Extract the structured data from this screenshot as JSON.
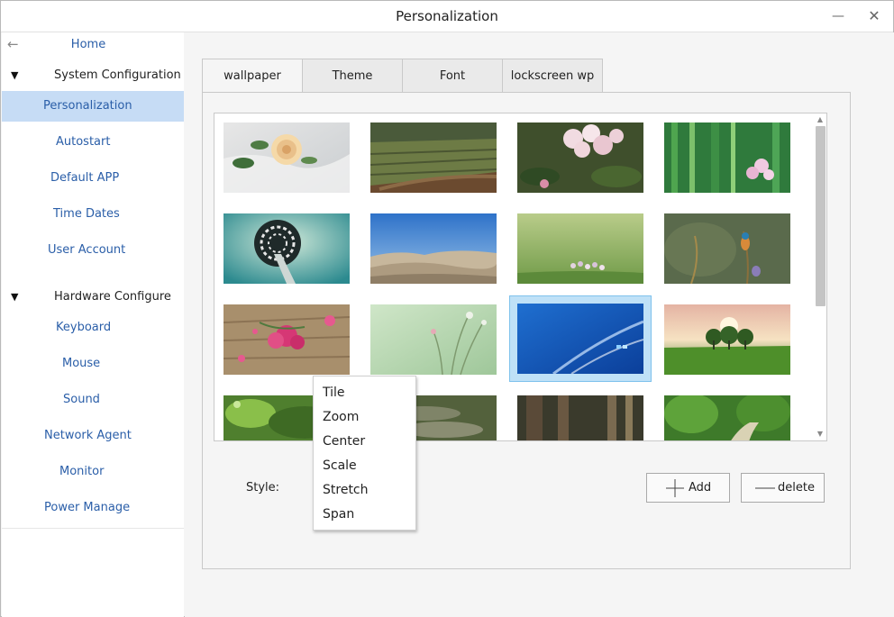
{
  "window": {
    "title": "Personalization",
    "minimize_glyph": "—",
    "close_glyph": "✕"
  },
  "sidebar": {
    "back_glyph": "←",
    "home_label": "Home",
    "groups": [
      {
        "label": "System Configuration",
        "expander_glyph": "▼"
      },
      {
        "label": "Hardware Configure",
        "expander_glyph": "▼"
      }
    ],
    "items": [
      {
        "label": "Personalization",
        "active": true
      },
      {
        "label": "Autostart"
      },
      {
        "label": "Default APP"
      },
      {
        "label": "Time Dates"
      },
      {
        "label": "User Account"
      },
      {
        "label": "Keyboard"
      },
      {
        "label": "Mouse"
      },
      {
        "label": "Sound"
      },
      {
        "label": "Network Agent"
      },
      {
        "label": "Monitor"
      },
      {
        "label": "Power Manage"
      }
    ]
  },
  "tabs": [
    {
      "label": "wallpaper",
      "active": true
    },
    {
      "label": "Theme"
    },
    {
      "label": "Font"
    },
    {
      "label": "lockscreen wp"
    }
  ],
  "gallery": {
    "wallpapers": [
      {
        "name": "rose-on-snow"
      },
      {
        "name": "mossy-roof"
      },
      {
        "name": "pink-rhododendron"
      },
      {
        "name": "bamboo-flower"
      },
      {
        "name": "tower-fisheye"
      },
      {
        "name": "desert-dunes"
      },
      {
        "name": "meadow-flowers"
      },
      {
        "name": "kingfisher"
      },
      {
        "name": "pink-petals-wood"
      },
      {
        "name": "green-watercolor"
      },
      {
        "name": "blue-swirl",
        "selected": true
      },
      {
        "name": "tree-sunset-field"
      },
      {
        "name": "mossy-forest"
      },
      {
        "name": "stone-path"
      },
      {
        "name": "tree-trunks"
      },
      {
        "name": "forest-path"
      }
    ],
    "scroll_up_glyph": "▲",
    "scroll_down_glyph": "▼"
  },
  "style": {
    "label": "Style:",
    "options": [
      "Tile",
      "Zoom",
      "Center",
      "Scale",
      "Stretch",
      "Span"
    ]
  },
  "buttons": {
    "add_label": "Add",
    "add_icon": "plus-icon",
    "delete_label": "delete",
    "delete_icon": "minus-icon"
  },
  "colors": {
    "accent_link": "#2a5ea8",
    "active_item_bg": "#c6dcf5",
    "selected_thumb_frame": "#bfe1f7"
  }
}
